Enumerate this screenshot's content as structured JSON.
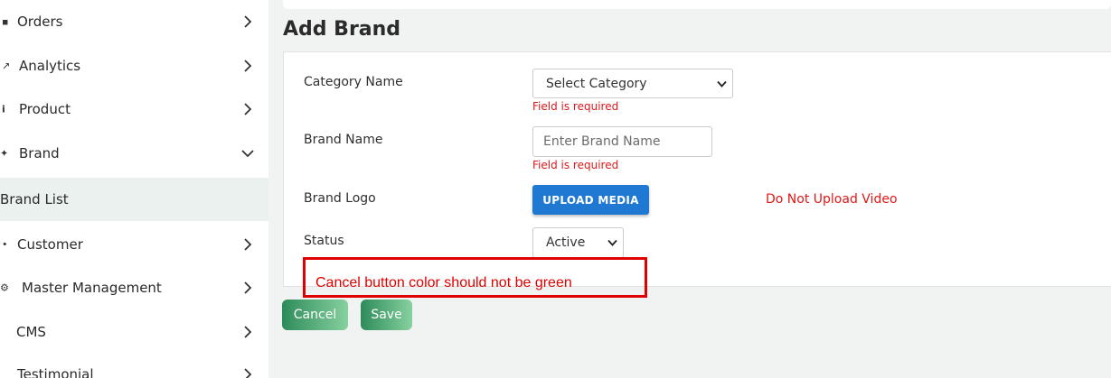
{
  "sidebar": {
    "items": [
      {
        "label": "Orders",
        "icon": "orders-icon",
        "glyph": "▪"
      },
      {
        "label": "Analytics",
        "icon": "analytics-icon",
        "glyph": "↗"
      },
      {
        "label": "Product",
        "icon": "product-icon",
        "glyph": "i"
      },
      {
        "label": "Brand",
        "icon": "brand-icon",
        "glyph": "✦"
      },
      {
        "label": "Customer",
        "icon": "customer-icon",
        "glyph": "•"
      },
      {
        "label": "Master Management",
        "icon": "gear-icon",
        "glyph": "⚙"
      },
      {
        "label": "CMS",
        "icon": "cms-icon",
        "glyph": ""
      },
      {
        "label": "Testimonial",
        "icon": "testimonial-icon",
        "glyph": ""
      }
    ],
    "sub_items": [
      {
        "label": "Brand List"
      }
    ]
  },
  "page": {
    "title": "Add Brand"
  },
  "form": {
    "category": {
      "label": "Category Name",
      "selected": "Select Category",
      "error": "Field is required"
    },
    "brand_name": {
      "label": "Brand Name",
      "placeholder": "Enter Brand Name",
      "value": "",
      "error": "Field is required"
    },
    "brand_logo": {
      "label": "Brand Logo",
      "button": "UPLOAD MEDIA",
      "warning": "Do Not Upload Video"
    },
    "status": {
      "label": "Status",
      "selected": "Active"
    }
  },
  "annotation": {
    "text": "Cancel button color should not be green",
    "color": "#e00000"
  },
  "actions": {
    "cancel_label": "Cancel",
    "save_label": "Save"
  },
  "colors": {
    "accent_blue": "#1f78d1",
    "button_green_start": "#2e8b5a",
    "button_green_end": "#86d19f",
    "error_red": "#e01818",
    "active_subitem_bg": "#eaf1ee"
  }
}
